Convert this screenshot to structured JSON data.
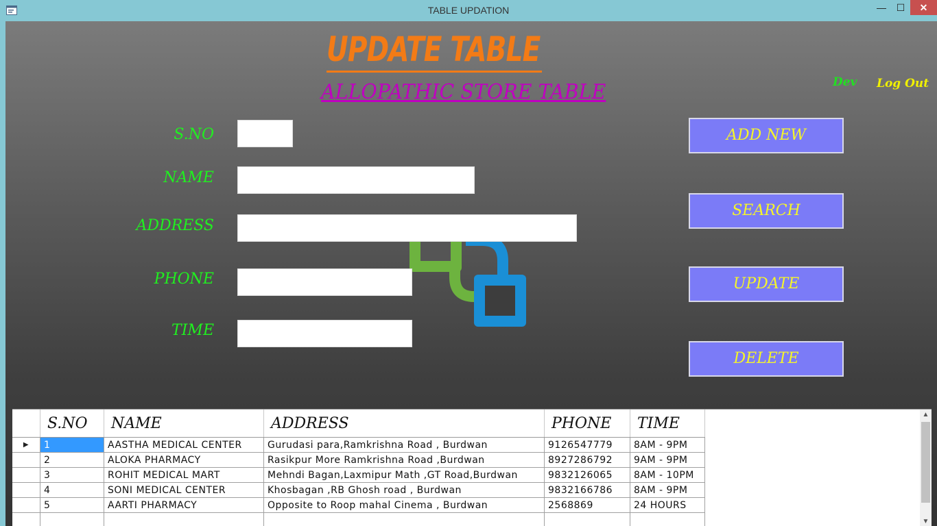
{
  "window": {
    "title": "TABLE UPDATION",
    "min_glyph": "—",
    "max_glyph": "☐",
    "close_glyph": "✕"
  },
  "header": {
    "title": "UPDATE TABLE",
    "subtitle": "ALLOPATHIC STORE TABLE",
    "dev_link": "Dev",
    "logout_link": "Log Out"
  },
  "form": {
    "sno_label": "S.NO",
    "name_label": "NAME",
    "address_label": "ADDRESS",
    "phone_label": "PHONE",
    "time_label": "TIME"
  },
  "buttons": {
    "add_new": "ADD NEW",
    "search": "SEARCH",
    "update": "UPDATE",
    "delete": "DELETE"
  },
  "grid": {
    "columns": [
      "S.NO",
      "NAME",
      "ADDRESS",
      "PHONE",
      "TIME"
    ],
    "rows": [
      {
        "sno": "1",
        "name": "AASTHA MEDICAL CENTER",
        "address": "Gurudasi para,Ramkrishna Road , Burdwan",
        "phone": "9126547779",
        "time": "8AM - 9PM"
      },
      {
        "sno": "2",
        "name": "ALOKA PHARMACY",
        "address": "Rasikpur More Ramkrishna Road ,Burdwan",
        "phone": "8927286792",
        "time": "9AM - 9PM"
      },
      {
        "sno": "3",
        "name": "ROHIT MEDICAL MART",
        "address": "Mehndi Bagan,Laxmipur Math ,GT Road,Burdwan",
        "phone": "9832126065",
        "time": "8AM - 10PM"
      },
      {
        "sno": "4",
        "name": "SONI MEDICAL CENTER",
        "address": "Khosbagan ,RB Ghosh road , Burdwan",
        "phone": "9832166786",
        "time": "8AM - 9PM"
      },
      {
        "sno": "5",
        "name": "AARTI PHARMACY",
        "address": "Opposite to Roop mahal Cinema , Burdwan",
        "phone": "2568869",
        "time": "24 HOURS"
      }
    ],
    "current_row_glyph": "▶"
  },
  "colors": {
    "heading": "#f37b16",
    "subtitle": "#c000c0",
    "label": "#20f020",
    "button_bg": "#7b7bf7",
    "button_text": "#f5f529"
  }
}
